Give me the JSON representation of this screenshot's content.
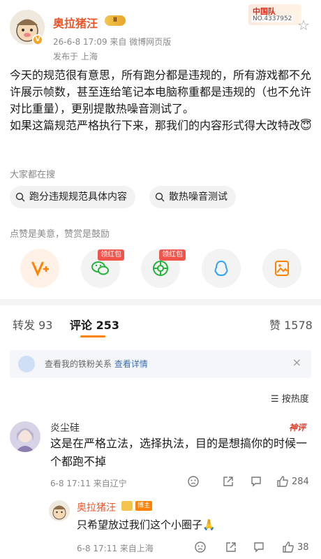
{
  "post": {
    "author": "奥拉猪汪",
    "level_badge": "Ⅱ",
    "verified_badge": "V",
    "time_source": "26-6-8 17:09  来自 微博网页版",
    "location": "发布于 上海",
    "fan_badge": {
      "title": "中国队",
      "number": "NO.4337952"
    },
    "paragraphs": [
      "今天的规范很有意思，所有跑分都是违规的，所有游戏都不允许展示帧数，甚至连给笔记本电脑称重都是违规的（也不允许对比重量），更别提散热噪音测试了。",
      "如果这篇规范严格执行下来，那我们的内容形式得大改特改😇"
    ]
  },
  "search": {
    "title": "大家都在搜",
    "chips": [
      "跑分违规规范具体内容",
      "散热噪音测试"
    ]
  },
  "like_hint": "点赞是美意，赞赏是鼓励",
  "share": {
    "items": [
      "supertopic-icon",
      "wechat-icon",
      "moments-icon",
      "qq-icon",
      "save-image-icon"
    ],
    "red_tag": "领红包"
  },
  "tabs": {
    "repost": "转发 93",
    "comment_label": "评论",
    "comment_count": "253",
    "likes": "赞 1578"
  },
  "fans_bar": {
    "text": "查看我的铁粉关系",
    "link": "查看详情",
    "close": "×"
  },
  "sort": "按热度",
  "comments": [
    {
      "name": "炎尘硅",
      "badge": "神评",
      "text": "这是在严格立法，选择执法，目的是想搞你的时候一个都跑不掉",
      "meta": "6-8 17:11  来自辽宁",
      "likes": "284"
    }
  ],
  "reply": {
    "name": "奥拉猪汪",
    "badge": "博主",
    "text": "只希望放过我们这个小圈子🙏",
    "meta": "6-8 17:11  来自上海",
    "likes": "38"
  },
  "colors": {
    "accent": "#ff8200",
    "name": "#e8562a",
    "link": "#3a6fb0",
    "red": "#f2544b"
  }
}
